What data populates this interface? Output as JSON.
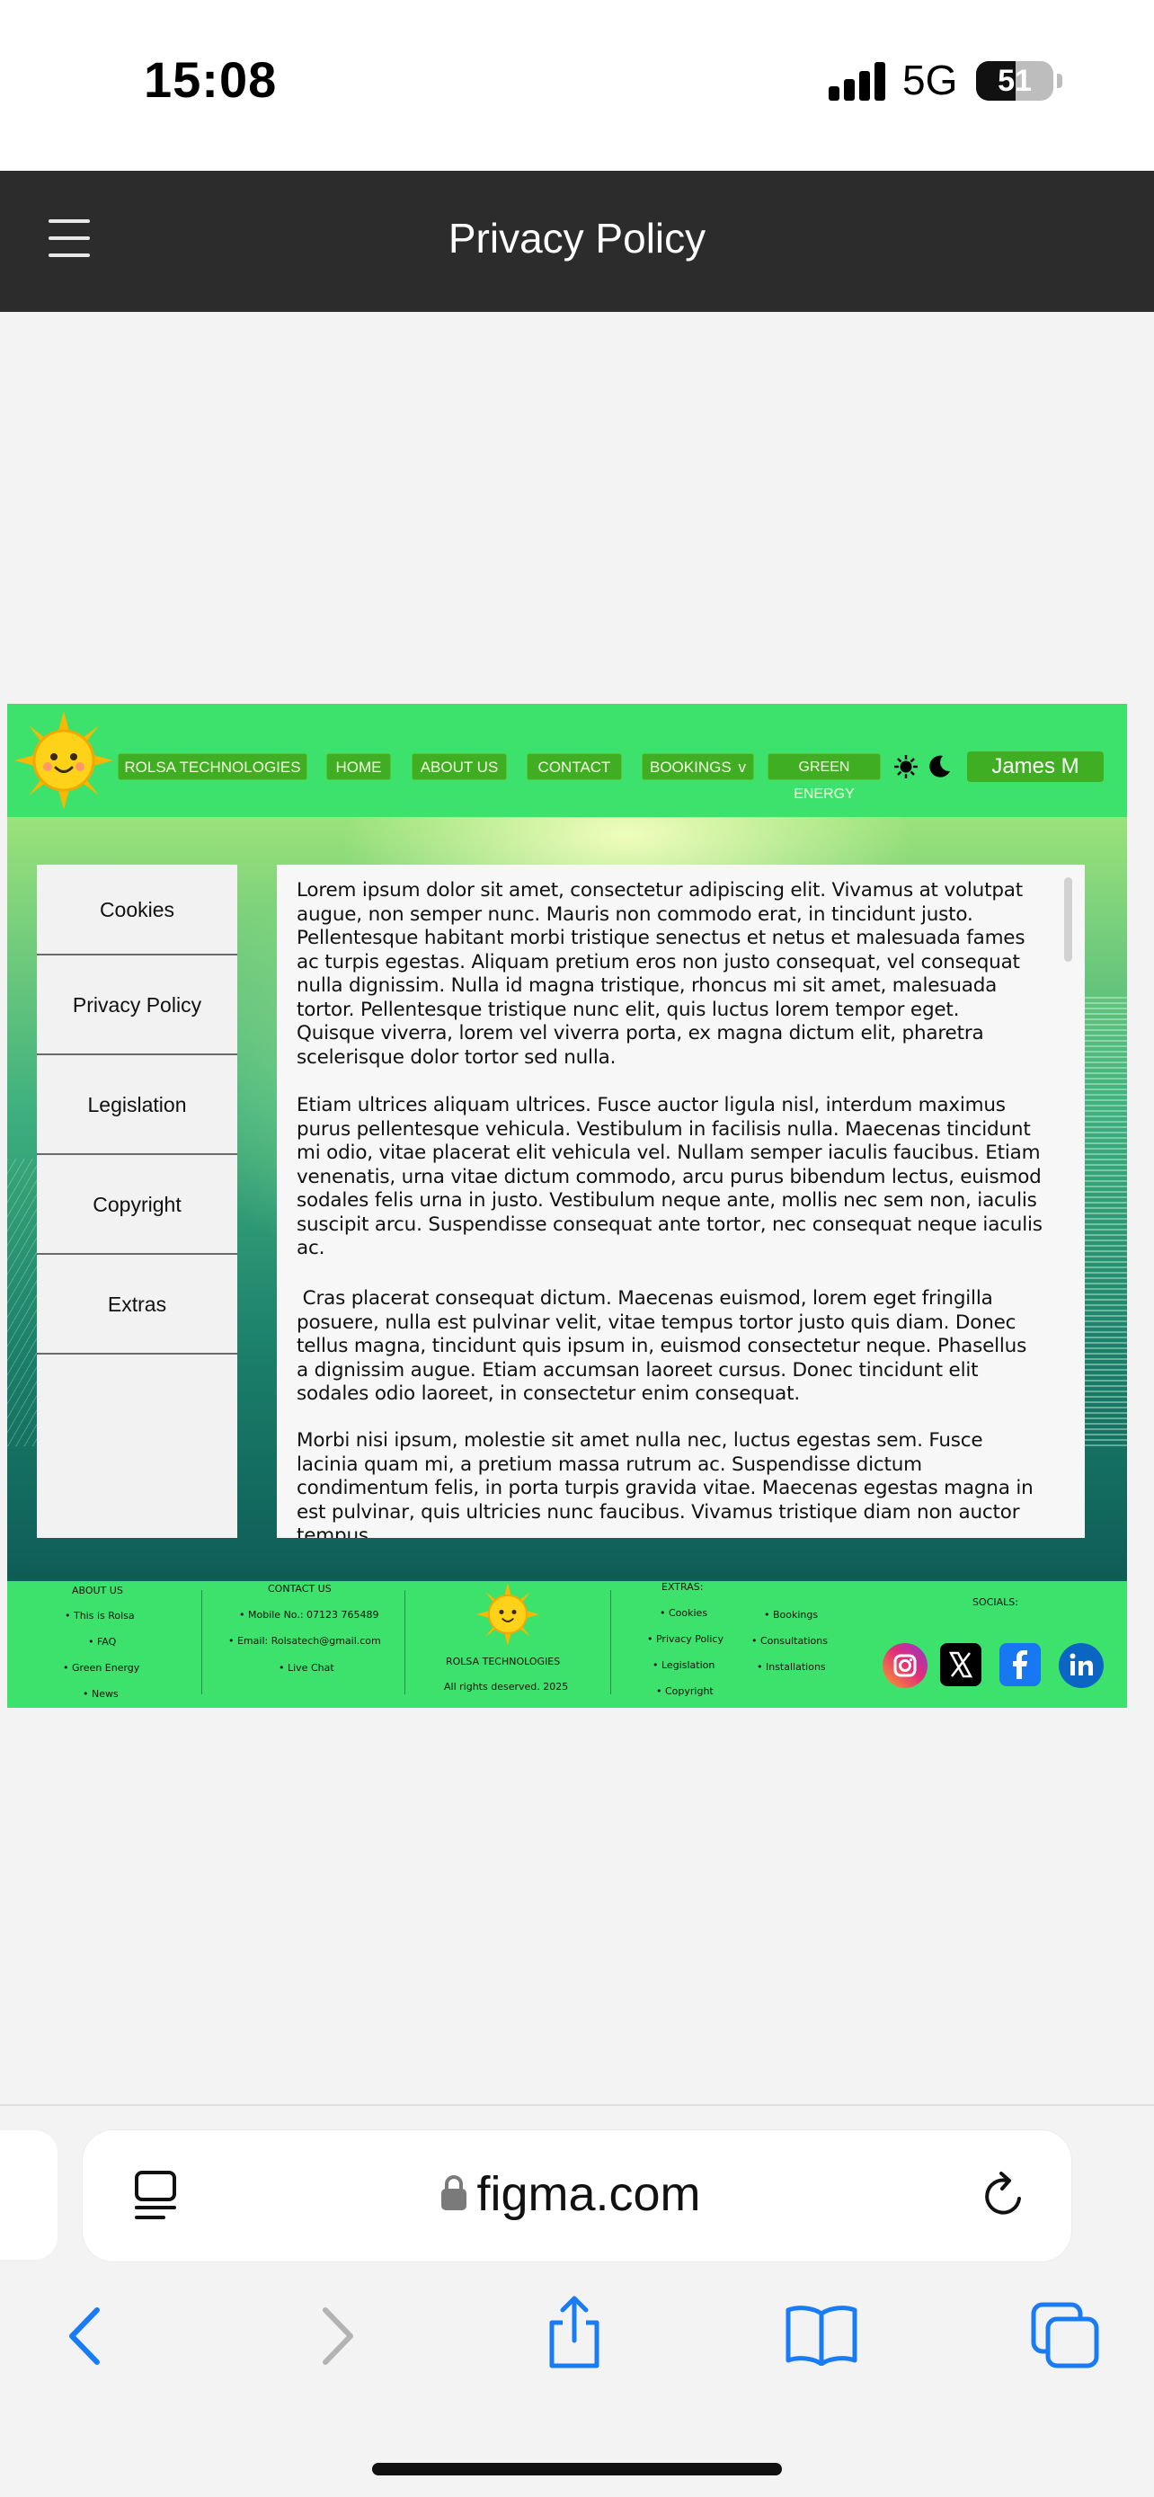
{
  "status_bar": {
    "time": "15:08",
    "network": "5G",
    "battery_level": "51",
    "battery_fraction": 0.51
  },
  "app_bar": {
    "title": "Privacy Policy"
  },
  "design": {
    "nav": {
      "items": [
        "ROLSA TECHNOLOGIES",
        "HOME",
        "ABOUT US",
        "CONTACT",
        "BOOKINGS",
        "GREEN ENERGY"
      ],
      "bookings_caret": "v",
      "user": "James M",
      "accent": "#3de26d",
      "button_color": "#3fae22"
    },
    "sidebar": {
      "items": [
        "Cookies",
        "Privacy Policy",
        "Legislation",
        "Copyright",
        "Extras"
      ]
    },
    "content": {
      "paragraphs": [
        "Lorem ipsum dolor sit amet, consectetur adipiscing elit. Vivamus at volutpat augue, non semper nunc. Mauris non commodo erat, in tincidunt justo. Pellentesque habitant morbi tristique senectus et netus et malesuada fames ac turpis egestas. Aliquam pretium eros non justo consequat, vel consequat nulla dignissim. Nulla id magna tristique, rhoncus mi sit amet, malesuada tortor. Pellentesque tristique nunc elit, quis luctus lorem tempor eget. Quisque viverra, lorem vel viverra porta, ex magna dictum elit, pharetra scelerisque dolor tortor sed nulla.",
        "Etiam ultrices aliquam ultrices. Fusce auctor ligula nisl, interdum maximus purus pellentesque vehicula. Vestibulum in facilisis nulla. Maecenas tincidunt mi odio, vitae placerat elit vehicula vel. Nullam semper iaculis faucibus. Etiam venenatis, urna vitae dictum commodo, arcu purus bibendum lectus, euismod sodales felis urna in justo. Vestibulum neque ante, mollis nec sem non, iaculis suscipit arcu. Suspendisse consequat ante tortor, nec consequat neque iaculis ac.",
        " Cras placerat consequat dictum. Maecenas euismod, lorem eget fringilla posuere, nulla est pulvinar velit, vitae tempus tortor justo quis diam. Donec tellus magna, tincidunt quis ipsum in, euismod consectetur neque. Phasellus a dignissim augue. Etiam accumsan laoreet cursus. Donec tincidunt elit sodales odio laoreet, in consectetur enim consequat.",
        "Morbi nisi ipsum, molestie sit amet nulla nec, luctus egestas sem. Fusce lacinia quam mi, a pretium massa rutrum ac. Suspendisse dictum condimentum felis, in porta turpis gravida vitae. Maecenas egestas magna in est pulvinar, quis ultricies nunc faucibus. Vivamus tristique diam non auctor tempus."
      ]
    },
    "footer": {
      "about": {
        "heading": "ABOUT US",
        "items": [
          "• This is Rolsa",
          "• FAQ",
          "• Green Energy",
          "• News"
        ]
      },
      "contact": {
        "heading": "CONTACT US",
        "items": [
          "• Mobile No.: 07123 765489",
          "• Email: Rolsatech@gmail.com",
          "• Live Chat"
        ]
      },
      "brand": {
        "name": "ROLSA TECHNOLOGIES",
        "rights": "All rights deserved. 2025"
      },
      "extras": {
        "heading": "EXTRAS:",
        "col1": [
          "• Cookies",
          "• Privacy Policy",
          "• Legislation",
          "• Copyright"
        ],
        "col2": [
          "• Bookings",
          "• Consultations",
          "• Installations"
        ]
      },
      "socials": {
        "heading": "SOCIALS:",
        "icons": [
          "instagram-icon",
          "x-icon",
          "facebook-icon",
          "linkedin-icon"
        ]
      }
    }
  },
  "browser": {
    "url": "figma.com"
  }
}
